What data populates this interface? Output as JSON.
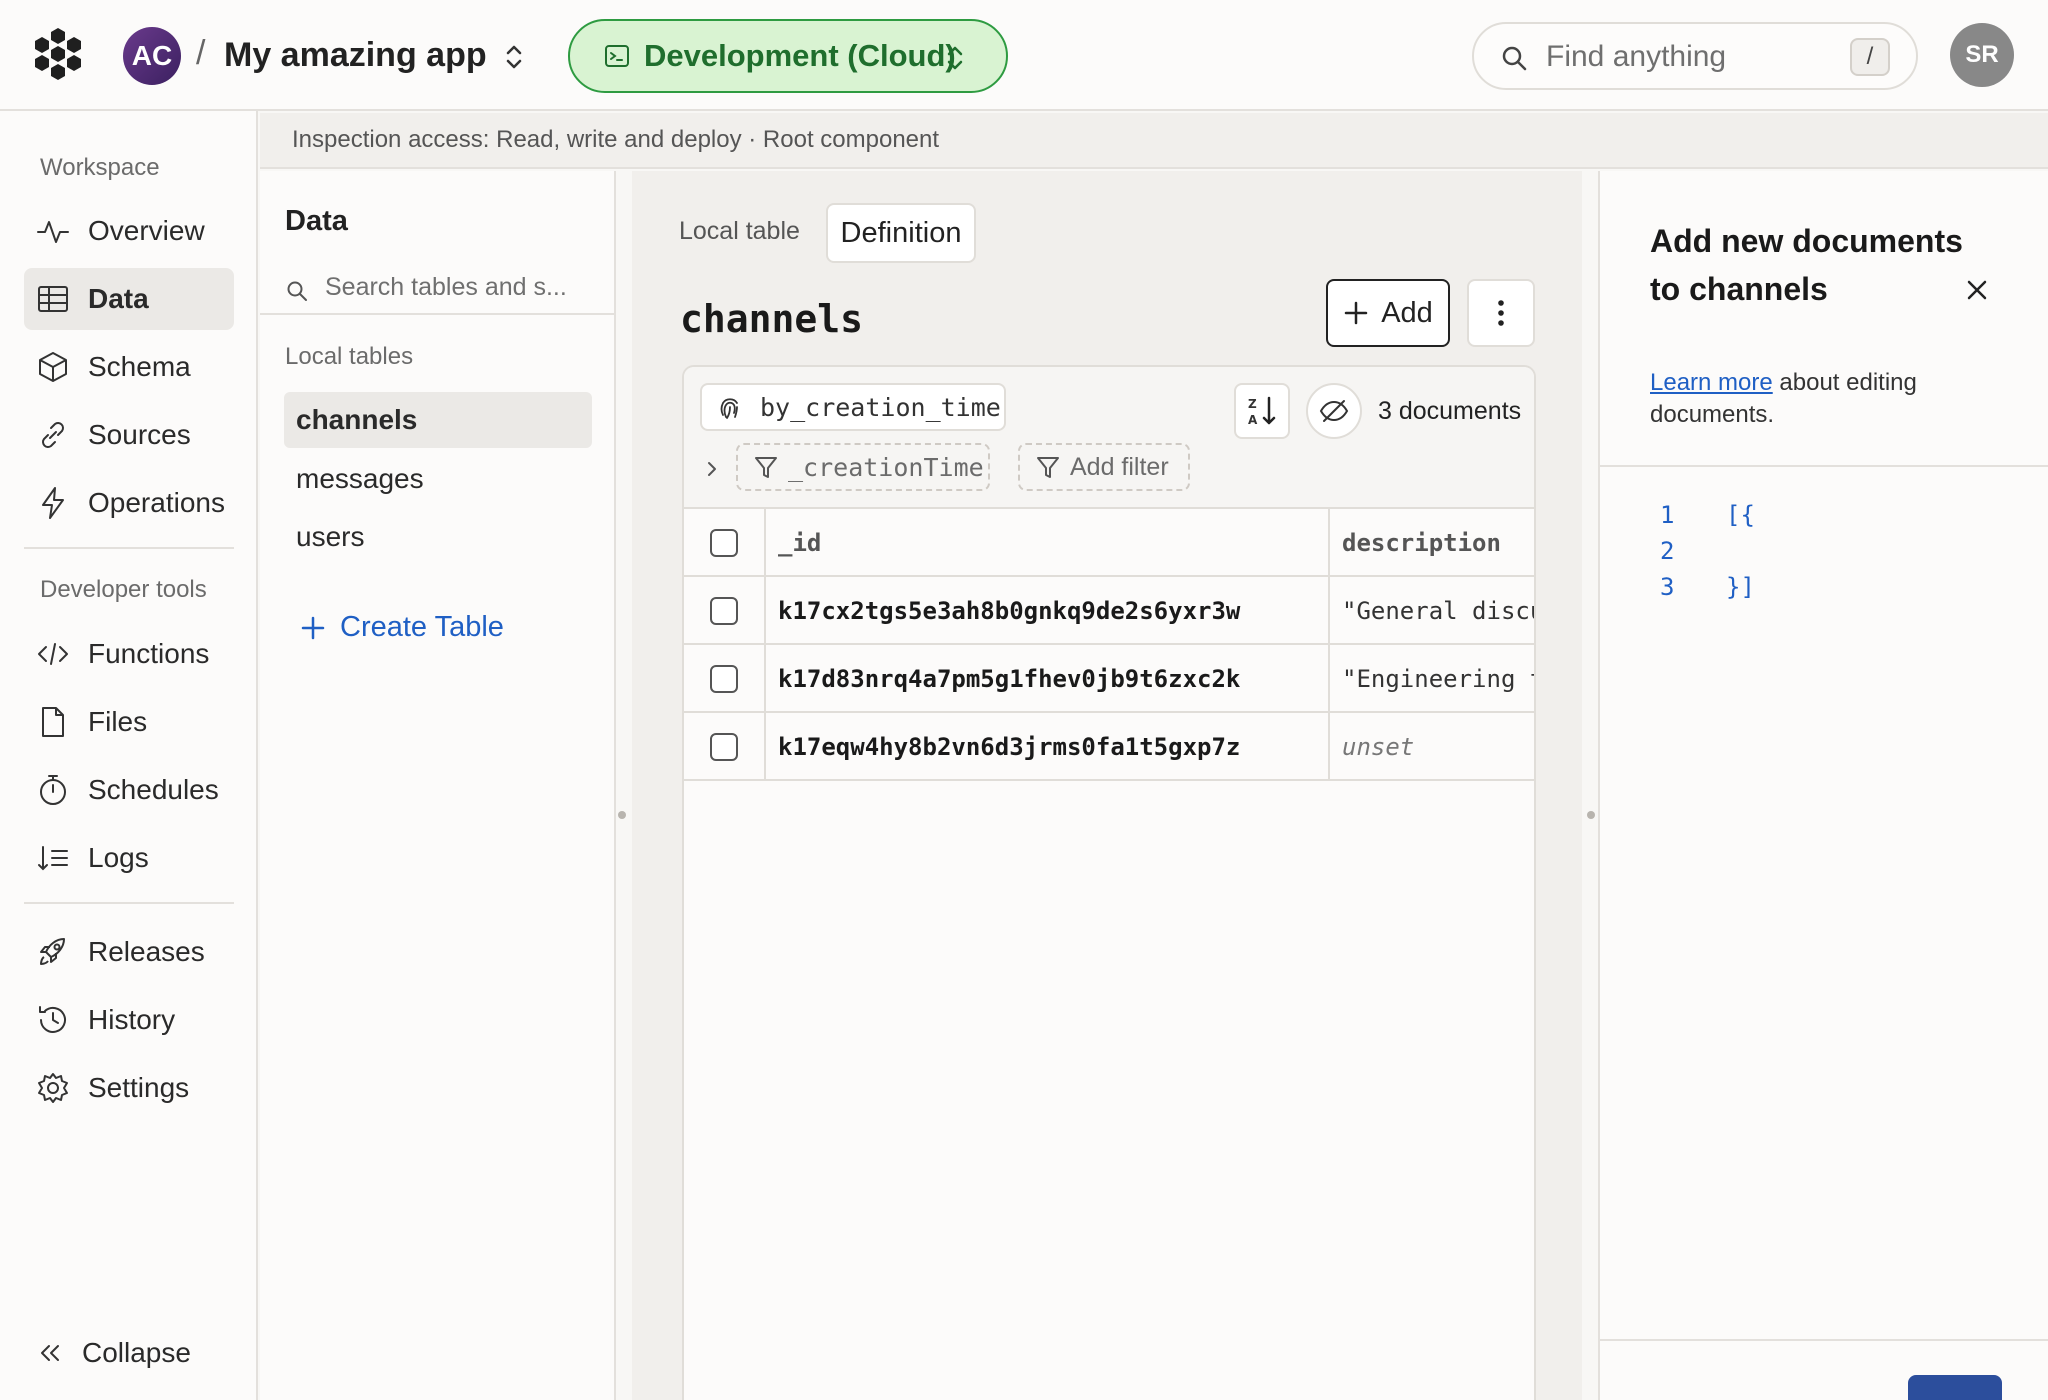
{
  "topbar": {
    "avatar_initials": "AC",
    "separator": "/",
    "project_name": "My amazing app",
    "deployment_label": "Development (Cloud)",
    "search_placeholder": "Find anything",
    "search_shortcut": "/",
    "user_initials": "SR",
    "colors": {
      "deployment_bg": "#d9f3d2",
      "deployment_border": "#2e9b41"
    }
  },
  "sidebar": {
    "workspace_heading": "Workspace",
    "workspace_items": [
      {
        "label": "Overview",
        "icon": "pulse-icon",
        "active": false
      },
      {
        "label": "Data",
        "icon": "table-icon",
        "active": true
      },
      {
        "label": "Schema",
        "icon": "cube-icon",
        "active": false
      },
      {
        "label": "Sources",
        "icon": "link-icon",
        "active": false
      },
      {
        "label": "Operations",
        "icon": "lightning-icon",
        "active": false
      }
    ],
    "devtools_heading": "Developer tools",
    "devtools_items": [
      {
        "label": "Functions",
        "icon": "code-icon"
      },
      {
        "label": "Files",
        "icon": "file-icon"
      },
      {
        "label": "Schedules",
        "icon": "stopwatch-icon"
      },
      {
        "label": "Logs",
        "icon": "sort-list-icon"
      }
    ],
    "bottom_items": [
      {
        "label": "Releases",
        "icon": "rocket-icon"
      },
      {
        "label": "History",
        "icon": "history-icon"
      },
      {
        "label": "Settings",
        "icon": "gear-icon"
      }
    ],
    "collapse_label": "Collapse"
  },
  "access_banner": "Inspection access: Read, write and deploy · Root component",
  "tables_panel": {
    "title": "Data",
    "search_placeholder": "Search tables and s...",
    "section_label": "Local tables",
    "tables": [
      "channels",
      "messages",
      "users"
    ],
    "active_table": "channels",
    "create_label": "Create Table"
  },
  "main": {
    "tabs": [
      "Local table",
      "Definition"
    ],
    "table_title": "channels",
    "add_label": "Add",
    "index_name": "by_creation_time",
    "document_count": "3 documents",
    "filters": [
      "_creationTime",
      "Add filter"
    ],
    "columns": [
      "_id",
      "description"
    ],
    "rows": [
      {
        "id": "k17cx2tgs5e3ah8b0gnkq9de2s6yxr3w",
        "description": "\"General discussion\"",
        "unset": false
      },
      {
        "id": "k17d83nrq4a7pm5g1fhev0jb9t6zxc2k",
        "description": "\"Engineering team\"",
        "unset": false
      },
      {
        "id": "k17eqw4hy8b2vn6d3jrms0fa1t5gxp7z",
        "description": "unset",
        "unset": true
      }
    ]
  },
  "right_panel": {
    "title": "Add new documents to channels",
    "learn_more": "Learn more",
    "description_suffix": " about editing documents.",
    "editor_lines": [
      {
        "num": "1",
        "text": "[{"
      },
      {
        "num": "2",
        "text": ""
      },
      {
        "num": "3",
        "text": "}]"
      }
    ]
  }
}
